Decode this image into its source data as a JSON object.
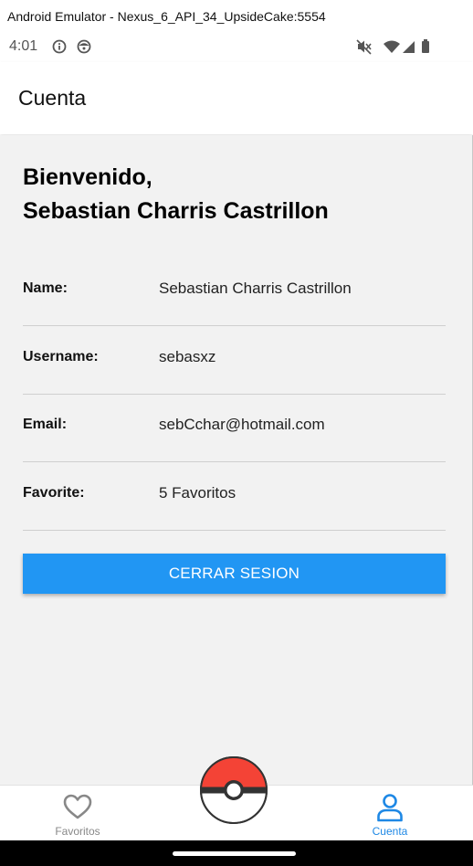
{
  "window": {
    "title": "Android Emulator - Nexus_6_API_34_UpsideCake:5554"
  },
  "status_bar": {
    "time": "4:01",
    "left_icons": [
      "info-icon",
      "face-icon"
    ],
    "right_icons": [
      "mute-icon",
      "wifi-icon",
      "signal-icon",
      "battery-icon"
    ]
  },
  "app_bar": {
    "title": "Cuenta"
  },
  "account": {
    "welcome_line1": "Bienvenido,",
    "welcome_line2": "Sebastian Charris Castrillon",
    "rows": [
      {
        "label": "Name:",
        "value": "Sebastian Charris Castrillon"
      },
      {
        "label": "Username:",
        "value": "sebasxz"
      },
      {
        "label": "Email:",
        "value": "sebCchar@hotmail.com"
      },
      {
        "label": "Favorite:",
        "value": "5 Favoritos"
      }
    ],
    "logout_label": "CERRAR SESION"
  },
  "bottom_nav": {
    "items": [
      {
        "label": "Favoritos",
        "icon": "heart-icon",
        "active": false
      },
      {
        "label": "Cuenta",
        "icon": "person-icon",
        "active": true
      }
    ],
    "center_icon": "pokeball-icon"
  },
  "colors": {
    "accent": "#2196f3",
    "nav_active": "#1e88e5",
    "nav_inactive": "#888888",
    "content_bg": "#f2f2f2",
    "pokeball_red": "#f44336"
  }
}
